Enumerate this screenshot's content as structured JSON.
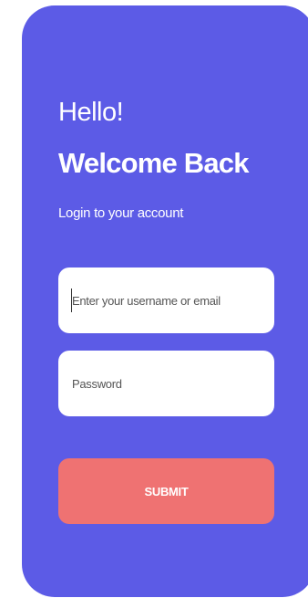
{
  "login": {
    "greeting": "Hello!",
    "welcome": "Welcome Back",
    "subtitle": "Login to your account",
    "username_placeholder": "Enter your username or email",
    "password_placeholder": "Password",
    "submit_label": "SUBMIT"
  },
  "colors": {
    "card_background": "#5c5be6",
    "submit_background": "#ef7272",
    "field_background": "#ffffff"
  }
}
